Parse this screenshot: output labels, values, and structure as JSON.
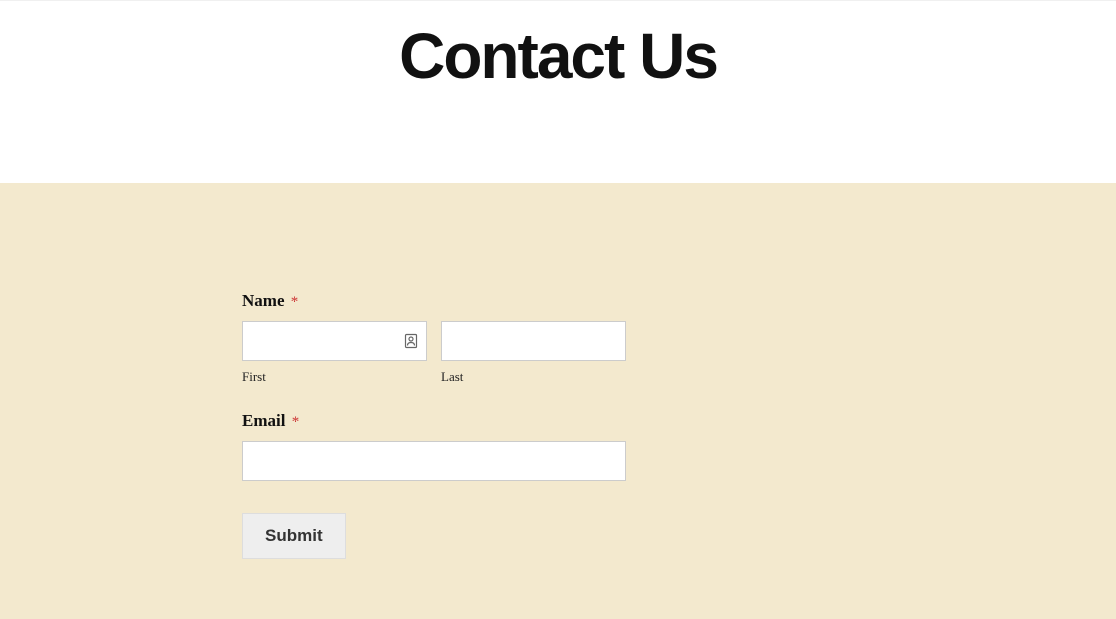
{
  "header": {
    "title": "Contact Us"
  },
  "form": {
    "name": {
      "label": "Name",
      "required_mark": "*",
      "first": {
        "value": "",
        "sub_label": "First"
      },
      "last": {
        "value": "",
        "sub_label": "Last"
      }
    },
    "email": {
      "label": "Email",
      "required_mark": "*",
      "value": ""
    },
    "submit": {
      "label": "Submit"
    }
  },
  "colors": {
    "form_background": "#f3e9ce",
    "page_background": "#ffffff",
    "required": "#cc3333"
  }
}
